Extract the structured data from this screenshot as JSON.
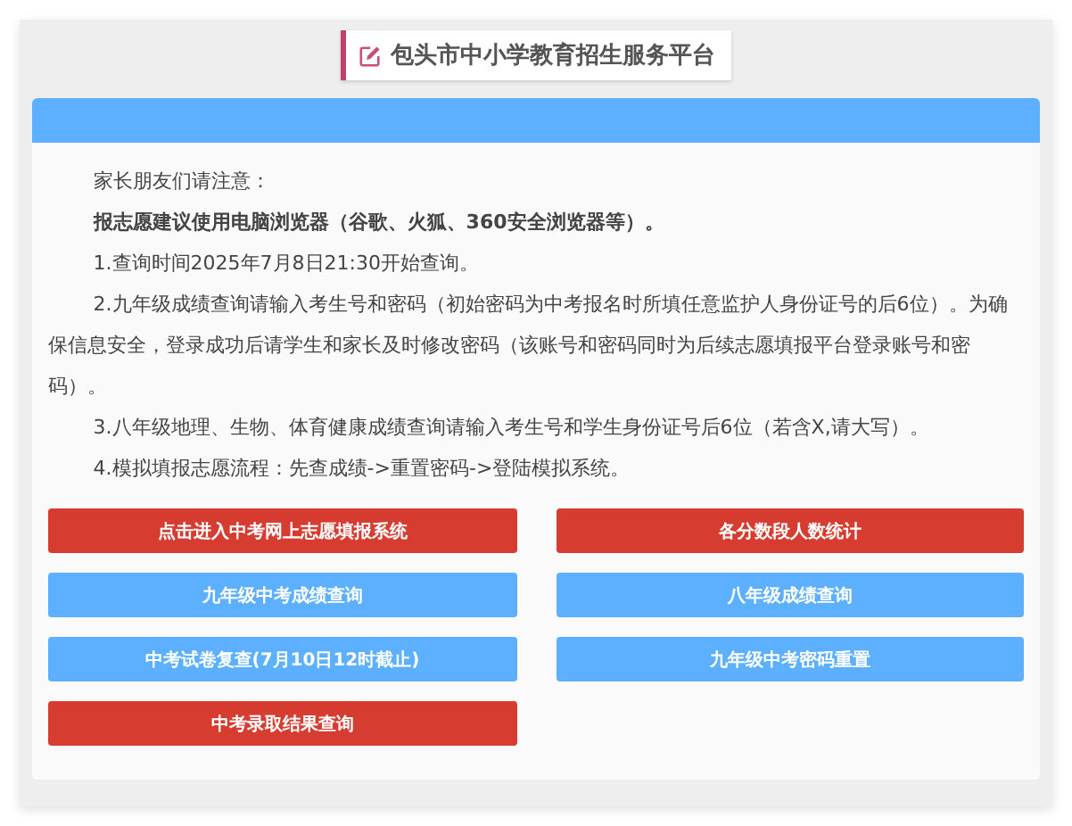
{
  "title": "包头市中小学教育招生服务平台",
  "notice": [
    {
      "text": "家长朋友们请注意：",
      "bold": false
    },
    {
      "text": "报志愿建议使用电脑浏览器（谷歌、火狐、360安全浏览器等）。",
      "bold": true
    },
    {
      "text": "1.查询时间2025年7月8日21:30开始查询。",
      "bold": false
    },
    {
      "text": "2.九年级成绩查询请输入考生号和密码（初始密码为中考报名时所填任意监护人身份证号的后6位）。为确保信息安全，登录成功后请学生和家长及时修改密码（该账号和密码同时为后续志愿填报平台登录账号和密码）。",
      "bold": false
    },
    {
      "text": "3.八年级地理、生物、体育健康成绩查询请输入考生号和学生身份证号后6位（若含X,请大写）。",
      "bold": false
    },
    {
      "text": "4.模拟填报志愿流程：先查成绩->重置密码->登陆模拟系统。",
      "bold": false
    }
  ],
  "buttons": [
    {
      "label": "点击进入中考网上志愿填报系统",
      "kind": "danger"
    },
    {
      "label": "各分数段人数统计",
      "kind": "danger"
    },
    {
      "label": "九年级中考成绩查询",
      "kind": "primary"
    },
    {
      "label": "八年级成绩查询",
      "kind": "primary"
    },
    {
      "label": "中考试卷复查(7月10日12时截止)",
      "kind": "primary"
    },
    {
      "label": "九年级中考密码重置",
      "kind": "primary"
    },
    {
      "label": "中考录取结果查询",
      "kind": "danger"
    }
  ]
}
